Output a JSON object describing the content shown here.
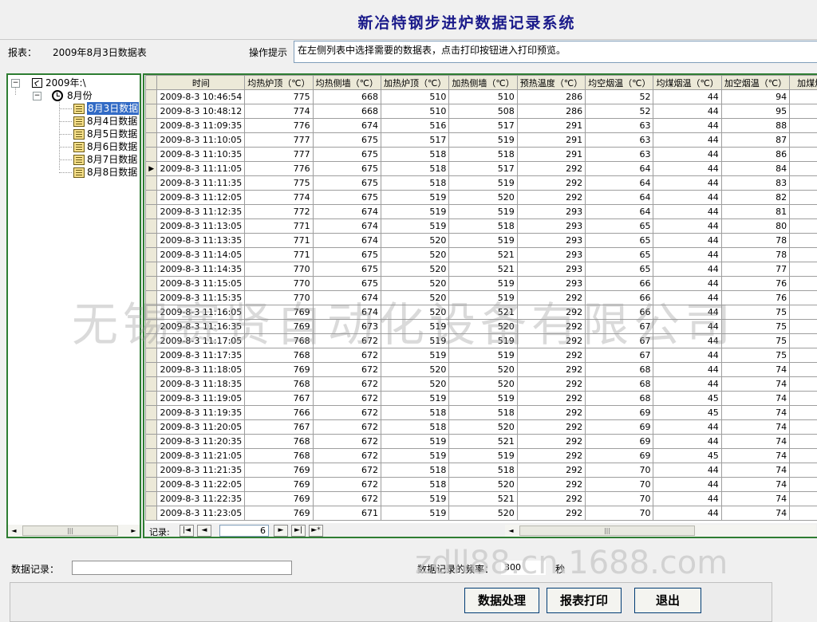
{
  "title": "新冶特钢步进炉数据记录系统",
  "report": {
    "label": "报表：",
    "value": "2009年8月3日数据表"
  },
  "hint": {
    "label": "操作提示",
    "text": "在左侧列表中选择需要的数据表，点击打印按钮进入打印预览。"
  },
  "tree": {
    "root": "2009年:\\",
    "month": "8月份",
    "items": [
      "8月3日数据",
      "8月4日数据",
      "8月5日数据",
      "8月6日数据",
      "8月7日数据",
      "8月8日数据"
    ],
    "selected_index": 0
  },
  "grid": {
    "columns": [
      "时间",
      "均热炉顶（℃）",
      "均热侧墙（℃）",
      "加热炉顶（℃）",
      "加热侧墙（℃）",
      "预热温度（℃）",
      "均空烟温（℃）",
      "均煤烟温（℃）",
      "加空烟温（℃）",
      "加煤烟"
    ],
    "current_row_index": 5,
    "current_row_marker": "▶",
    "rows": [
      [
        "2009-8-3 10:46:54",
        "775",
        "668",
        "510",
        "510",
        "286",
        "52",
        "44",
        "94"
      ],
      [
        "2009-8-3 10:48:12",
        "774",
        "668",
        "510",
        "508",
        "286",
        "52",
        "44",
        "95"
      ],
      [
        "2009-8-3 11:09:35",
        "776",
        "674",
        "516",
        "517",
        "291",
        "63",
        "44",
        "88"
      ],
      [
        "2009-8-3 11:10:05",
        "777",
        "675",
        "517",
        "519",
        "291",
        "63",
        "44",
        "87"
      ],
      [
        "2009-8-3 11:10:35",
        "777",
        "675",
        "518",
        "518",
        "291",
        "63",
        "44",
        "86"
      ],
      [
        "2009-8-3 11:11:05",
        "776",
        "675",
        "518",
        "517",
        "292",
        "64",
        "44",
        "84"
      ],
      [
        "2009-8-3 11:11:35",
        "775",
        "675",
        "518",
        "519",
        "292",
        "64",
        "44",
        "83"
      ],
      [
        "2009-8-3 11:12:05",
        "774",
        "675",
        "519",
        "520",
        "292",
        "64",
        "44",
        "82"
      ],
      [
        "2009-8-3 11:12:35",
        "772",
        "674",
        "519",
        "519",
        "293",
        "64",
        "44",
        "81"
      ],
      [
        "2009-8-3 11:13:05",
        "771",
        "674",
        "519",
        "518",
        "293",
        "65",
        "44",
        "80"
      ],
      [
        "2009-8-3 11:13:35",
        "771",
        "674",
        "520",
        "519",
        "293",
        "65",
        "44",
        "78"
      ],
      [
        "2009-8-3 11:14:05",
        "771",
        "675",
        "520",
        "521",
        "293",
        "65",
        "44",
        "78"
      ],
      [
        "2009-8-3 11:14:35",
        "770",
        "675",
        "520",
        "521",
        "293",
        "65",
        "44",
        "77"
      ],
      [
        "2009-8-3 11:15:05",
        "770",
        "675",
        "520",
        "519",
        "293",
        "66",
        "44",
        "76"
      ],
      [
        "2009-8-3 11:15:35",
        "770",
        "674",
        "520",
        "519",
        "292",
        "66",
        "44",
        "76"
      ],
      [
        "2009-8-3 11:16:05",
        "769",
        "674",
        "520",
        "521",
        "292",
        "66",
        "44",
        "75"
      ],
      [
        "2009-8-3 11:16:35",
        "769",
        "673",
        "519",
        "520",
        "292",
        "67",
        "44",
        "75"
      ],
      [
        "2009-8-3 11:17:05",
        "768",
        "672",
        "519",
        "519",
        "292",
        "67",
        "44",
        "75"
      ],
      [
        "2009-8-3 11:17:35",
        "768",
        "672",
        "519",
        "519",
        "292",
        "67",
        "44",
        "75"
      ],
      [
        "2009-8-3 11:18:05",
        "769",
        "672",
        "520",
        "520",
        "292",
        "68",
        "44",
        "74"
      ],
      [
        "2009-8-3 11:18:35",
        "768",
        "672",
        "520",
        "520",
        "292",
        "68",
        "44",
        "74"
      ],
      [
        "2009-8-3 11:19:05",
        "767",
        "672",
        "519",
        "519",
        "292",
        "68",
        "45",
        "74"
      ],
      [
        "2009-8-3 11:19:35",
        "766",
        "672",
        "518",
        "518",
        "292",
        "69",
        "45",
        "74"
      ],
      [
        "2009-8-3 11:20:05",
        "767",
        "672",
        "518",
        "520",
        "292",
        "69",
        "44",
        "74"
      ],
      [
        "2009-8-3 11:20:35",
        "768",
        "672",
        "519",
        "521",
        "292",
        "69",
        "44",
        "74"
      ],
      [
        "2009-8-3 11:21:05",
        "768",
        "672",
        "519",
        "519",
        "292",
        "69",
        "45",
        "74"
      ],
      [
        "2009-8-3 11:21:35",
        "769",
        "672",
        "518",
        "518",
        "292",
        "70",
        "44",
        "74"
      ],
      [
        "2009-8-3 11:22:05",
        "769",
        "672",
        "518",
        "520",
        "292",
        "70",
        "44",
        "74"
      ],
      [
        "2009-8-3 11:22:35",
        "769",
        "672",
        "519",
        "521",
        "292",
        "70",
        "44",
        "74"
      ],
      [
        "2009-8-3 11:23:05",
        "769",
        "671",
        "519",
        "520",
        "292",
        "70",
        "44",
        "74"
      ]
    ]
  },
  "navigator": {
    "label": "记录:",
    "current_record": "6"
  },
  "watermark": "无锡赛贤自动化设备有限公司",
  "watermark2": "zdll88.cn.1688.com",
  "bottom": {
    "record_label": "数据记录：",
    "frequency_label": "数据记录的频率：",
    "frequency_value": "300",
    "frequency_unit": "秒"
  },
  "buttons": {
    "process": "数据处理",
    "print": "报表打印",
    "exit": "退出"
  },
  "colors": {
    "title": "#1a1a8a",
    "panel_border": "#2e7d32",
    "selection": "#316ac5"
  }
}
